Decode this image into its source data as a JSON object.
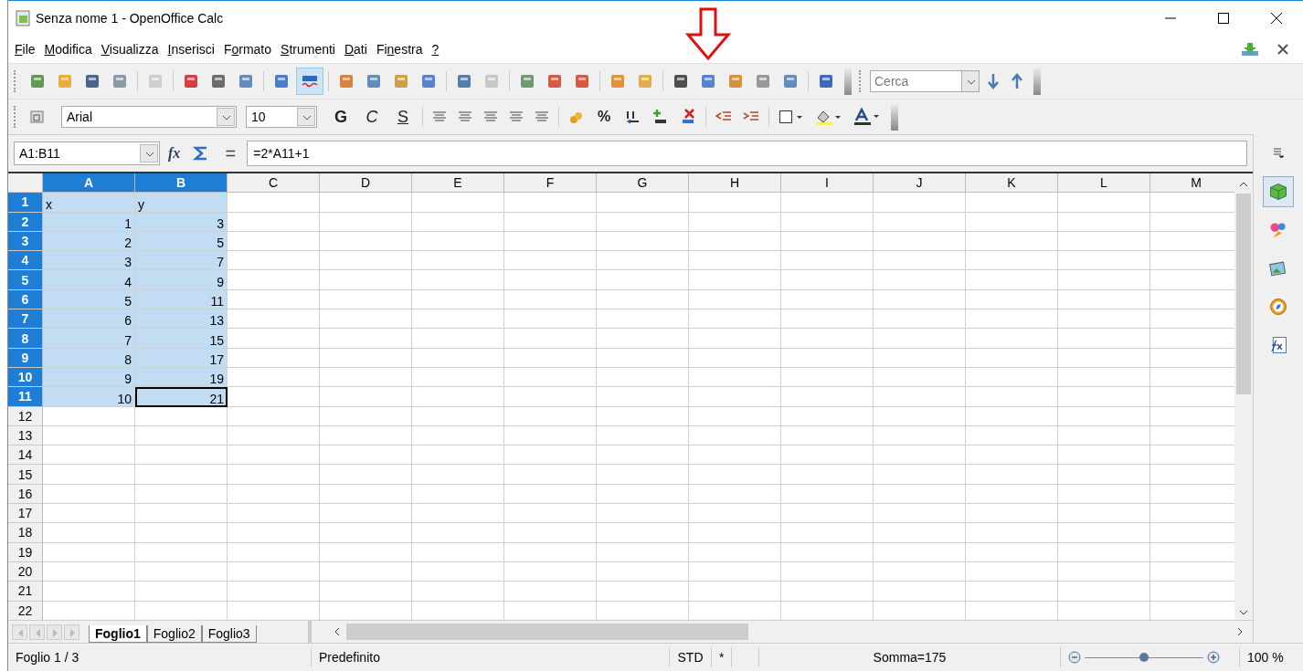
{
  "window": {
    "title": "Senza nome 1 - OpenOffice Calc"
  },
  "menu": [
    {
      "key": "F",
      "post": "ile"
    },
    {
      "key": "M",
      "post": "odifica"
    },
    {
      "key": "V",
      "post": "isualizza"
    },
    {
      "key": "I",
      "post": "nserisci"
    },
    {
      "pre": "F",
      "key": "o",
      "post": "rmato"
    },
    {
      "key": "S",
      "post": "trumenti"
    },
    {
      "key": "D",
      "post": "ati"
    },
    {
      "pre": "Fi",
      "key": "n",
      "post": "estra"
    },
    {
      "key": "?"
    }
  ],
  "standard_toolbar": {
    "autospell_on": true,
    "search": {
      "placeholder": "Cerca"
    }
  },
  "format_toolbar": {
    "font": "Arial",
    "size": "10",
    "style_buttons": [
      "G",
      "C",
      "S"
    ],
    "percent": "%"
  },
  "formula_bar": {
    "name_box": "A1:B11",
    "function_label": "fx",
    "equals": "=",
    "formula": "=2*A11+1"
  },
  "columns": [
    {
      "label": "A",
      "selected": true
    },
    {
      "label": "B",
      "selected": true
    },
    {
      "label": "C",
      "selected": false
    },
    {
      "label": "D",
      "selected": false
    },
    {
      "label": "E",
      "selected": false
    },
    {
      "label": "F",
      "selected": false
    },
    {
      "label": "G",
      "selected": false
    },
    {
      "label": "H",
      "selected": false
    },
    {
      "label": "I",
      "selected": false
    },
    {
      "label": "J",
      "selected": false
    },
    {
      "label": "K",
      "selected": false
    },
    {
      "label": "L",
      "selected": false
    },
    {
      "label": "M",
      "selected": false
    }
  ],
  "rows": [
    {
      "label": "1",
      "selected": true,
      "cells": [
        {
          "value": "x",
          "kind": "text",
          "active": false
        },
        {
          "value": "y",
          "kind": "text",
          "active": false
        }
      ]
    },
    {
      "label": "2",
      "selected": true,
      "cells": [
        {
          "value": "1",
          "kind": "number",
          "active": false
        },
        {
          "value": "3",
          "kind": "number",
          "active": false
        }
      ]
    },
    {
      "label": "3",
      "selected": true,
      "cells": [
        {
          "value": "2",
          "kind": "number",
          "active": false
        },
        {
          "value": "5",
          "kind": "number",
          "active": false
        }
      ]
    },
    {
      "label": "4",
      "selected": true,
      "cells": [
        {
          "value": "3",
          "kind": "number",
          "active": false
        },
        {
          "value": "7",
          "kind": "number",
          "active": false
        }
      ]
    },
    {
      "label": "5",
      "selected": true,
      "cells": [
        {
          "value": "4",
          "kind": "number",
          "active": false
        },
        {
          "value": "9",
          "kind": "number",
          "active": false
        }
      ]
    },
    {
      "label": "6",
      "selected": true,
      "cells": [
        {
          "value": "5",
          "kind": "number",
          "active": false
        },
        {
          "value": "11",
          "kind": "number",
          "active": false
        }
      ]
    },
    {
      "label": "7",
      "selected": true,
      "cells": [
        {
          "value": "6",
          "kind": "number",
          "active": false
        },
        {
          "value": "13",
          "kind": "number",
          "active": false
        }
      ]
    },
    {
      "label": "8",
      "selected": true,
      "cells": [
        {
          "value": "7",
          "kind": "number",
          "active": false
        },
        {
          "value": "15",
          "kind": "number",
          "active": false
        }
      ]
    },
    {
      "label": "9",
      "selected": true,
      "cells": [
        {
          "value": "8",
          "kind": "number",
          "active": false
        },
        {
          "value": "17",
          "kind": "number",
          "active": false
        }
      ]
    },
    {
      "label": "10",
      "selected": true,
      "cells": [
        {
          "value": "9",
          "kind": "number",
          "active": false
        },
        {
          "value": "19",
          "kind": "number",
          "active": false
        }
      ]
    },
    {
      "label": "11",
      "selected": true,
      "cells": [
        {
          "value": "10",
          "kind": "number",
          "active": false
        },
        {
          "value": "21",
          "kind": "number",
          "active": true
        }
      ]
    },
    {
      "label": "12",
      "selected": false
    },
    {
      "label": "13",
      "selected": false
    },
    {
      "label": "14",
      "selected": false
    },
    {
      "label": "15",
      "selected": false
    },
    {
      "label": "16",
      "selected": false
    },
    {
      "label": "17",
      "selected": false
    },
    {
      "label": "18",
      "selected": false
    },
    {
      "label": "19",
      "selected": false
    },
    {
      "label": "20",
      "selected": false
    },
    {
      "label": "21",
      "selected": false
    },
    {
      "label": "22",
      "selected": false
    }
  ],
  "sheet_tabs": [
    {
      "label": "Foglio1",
      "selected": true
    },
    {
      "label": "Foglio2",
      "selected": false
    },
    {
      "label": "Foglio3",
      "selected": false
    }
  ],
  "sidebar": {
    "items": [
      {
        "kind": "properties",
        "selected": true
      },
      {
        "kind": "styles",
        "selected": false
      },
      {
        "kind": "gallery",
        "selected": false
      },
      {
        "kind": "navigator",
        "selected": false
      },
      {
        "kind": "functions",
        "selected": false
      }
    ]
  },
  "status_bar": {
    "sheet": "Foglio 1 / 3",
    "page_style": "Predefinito",
    "mode": "STD",
    "modified": "*",
    "sum": "Somma=175",
    "zoom": {
      "level": 0.5,
      "reading": "100 %"
    }
  }
}
